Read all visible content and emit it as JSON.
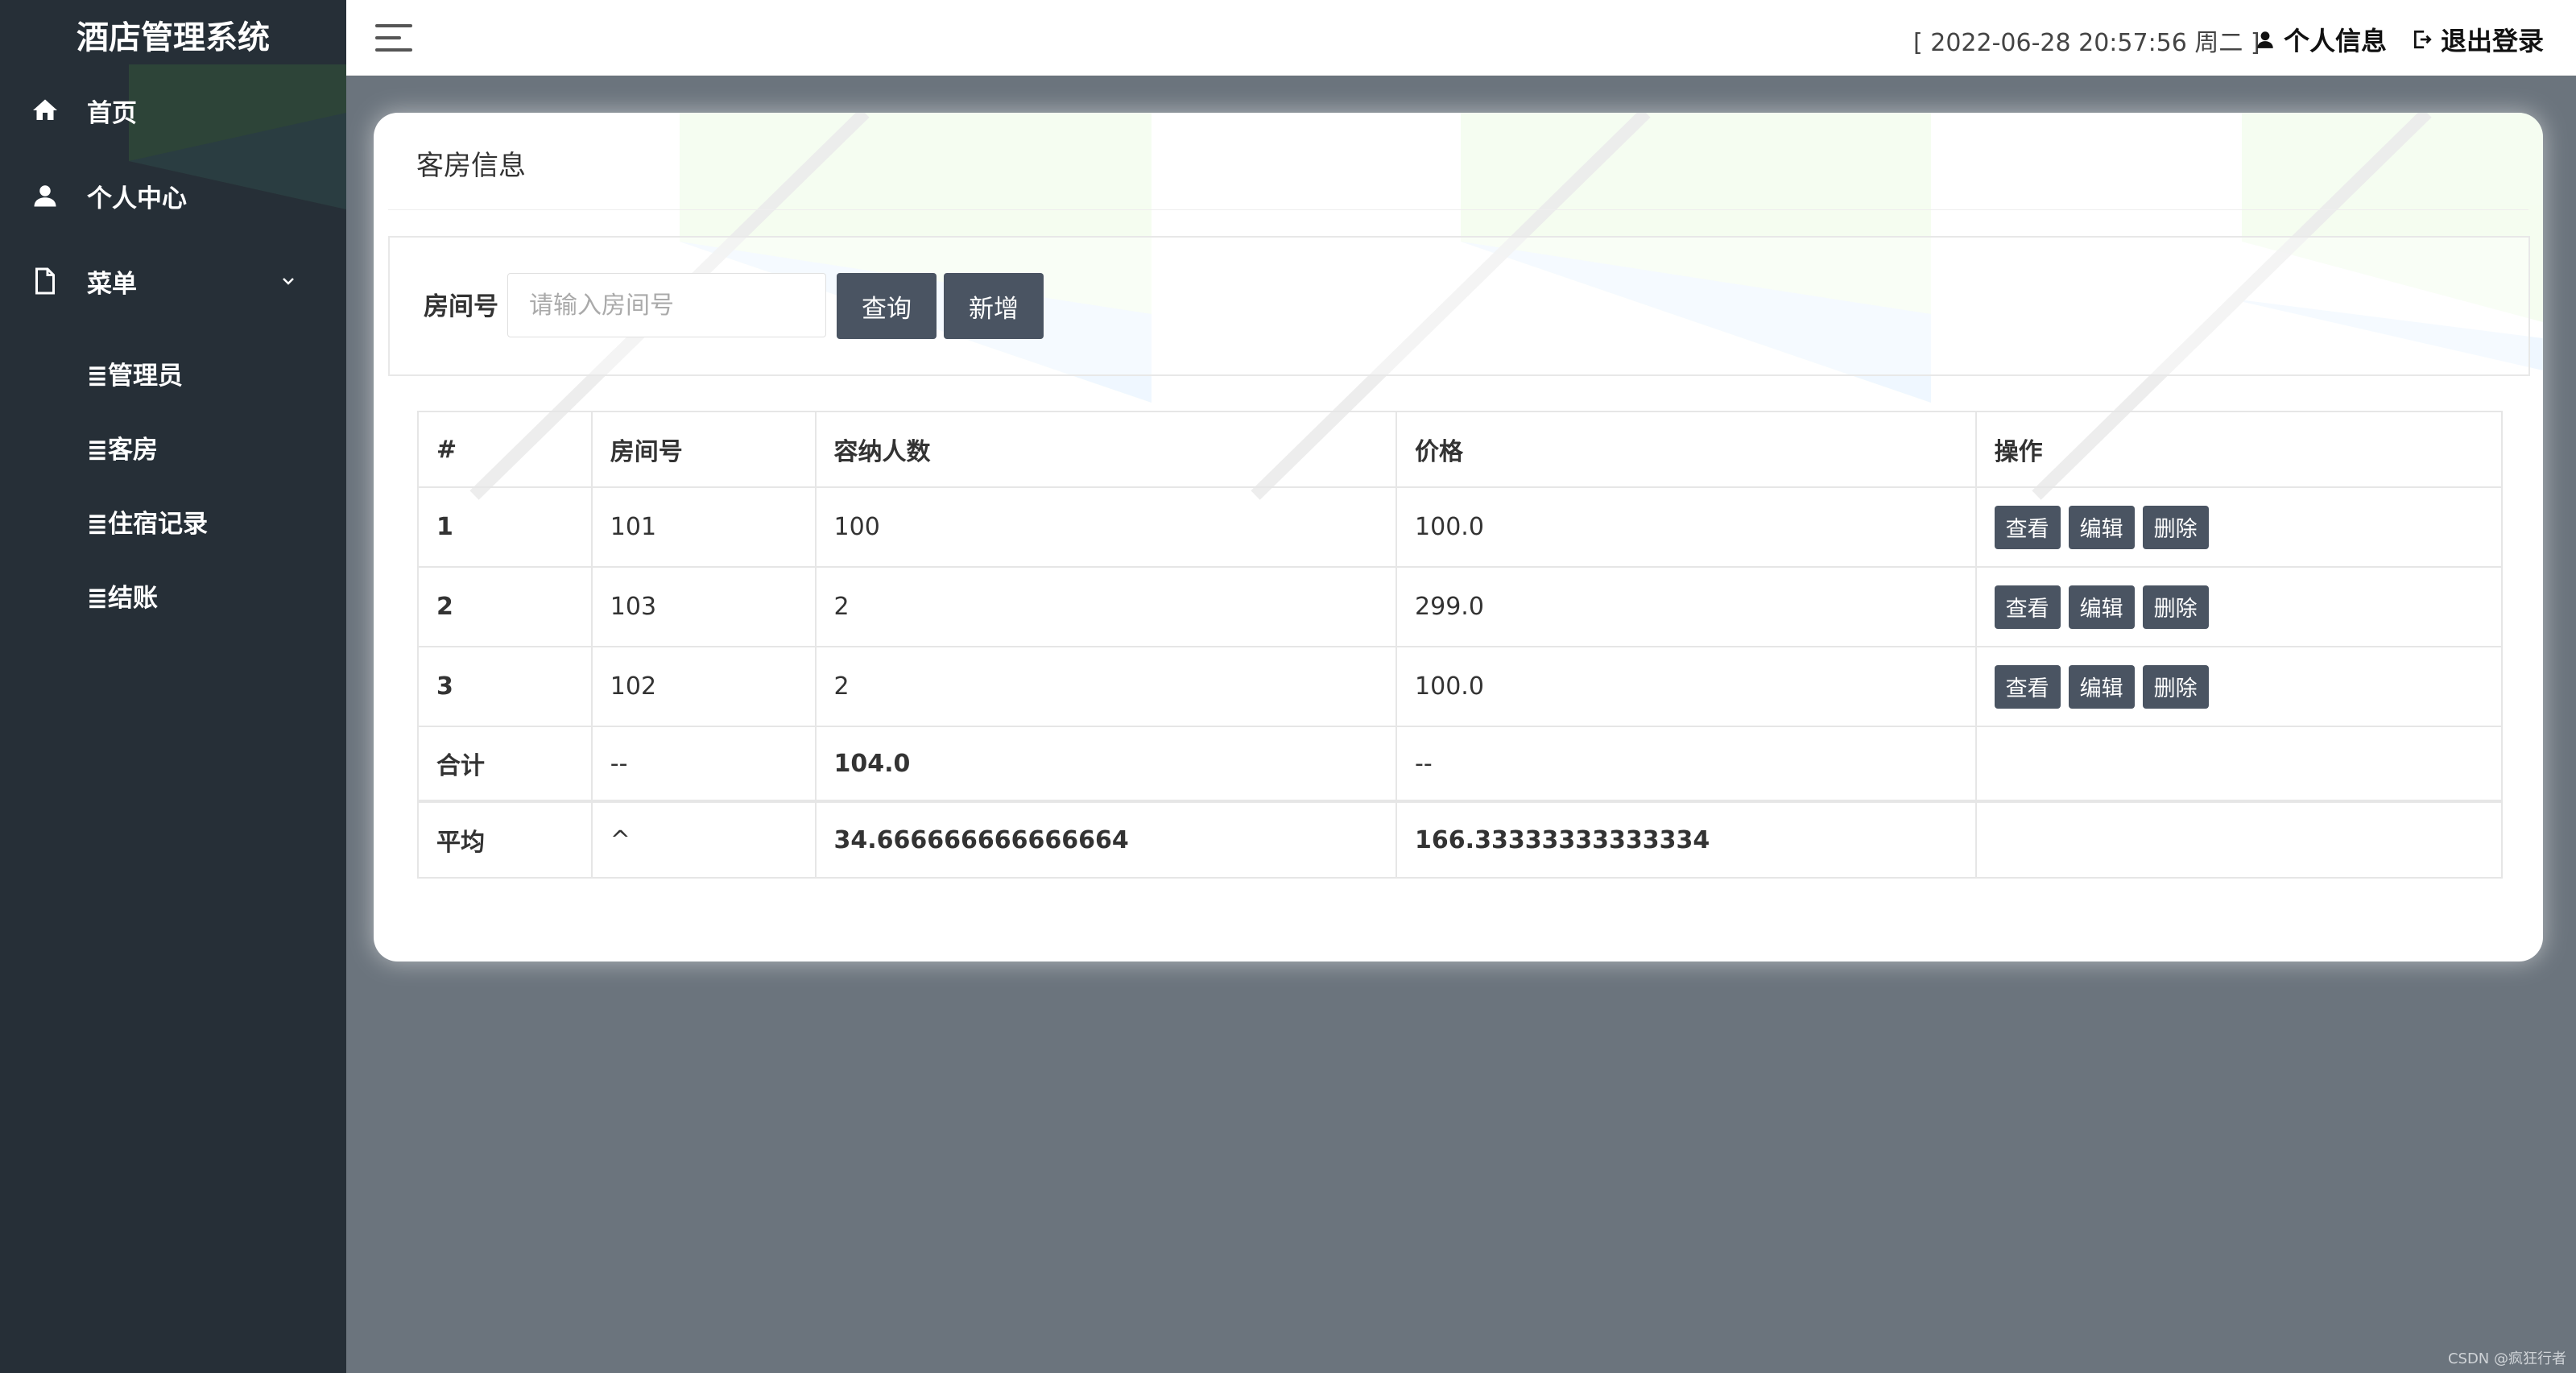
{
  "app": {
    "title": "酒店管理系统"
  },
  "sidebar": {
    "items": [
      {
        "label": "首页",
        "icon": "home-icon"
      },
      {
        "label": "个人中心",
        "icon": "user-icon"
      },
      {
        "label": "菜单",
        "icon": "document-icon"
      }
    ],
    "submenu": [
      {
        "label": "≣管理员"
      },
      {
        "label": "≣客房"
      },
      {
        "label": "≣住宿记录"
      },
      {
        "label": "≣结账"
      }
    ]
  },
  "header": {
    "datetime": "[ 2022-06-28 20:57:56 周二 ]",
    "profile_label": "个人信息",
    "logout_label": "退出登录"
  },
  "page": {
    "title": "客房信息"
  },
  "search": {
    "label": "房间号",
    "placeholder": "请输入房间号",
    "query_button": "查询",
    "add_button": "新增"
  },
  "table": {
    "headers": [
      "#",
      "房间号",
      "容纳人数",
      "价格",
      "操作"
    ],
    "rows": [
      {
        "index": "1",
        "room": "101",
        "capacity": "100",
        "price": "100.0"
      },
      {
        "index": "2",
        "room": "103",
        "capacity": "2",
        "price": "299.0"
      },
      {
        "index": "3",
        "room": "102",
        "capacity": "2",
        "price": "100.0"
      }
    ],
    "actions": {
      "view": "查看",
      "edit": "编辑",
      "delete": "删除"
    },
    "sum": {
      "label": "合计",
      "room": "--",
      "capacity": "104.0",
      "price": "--"
    },
    "avg": {
      "label": "平均",
      "room": "^",
      "capacity": "34.666666666666664",
      "price": "166.33333333333334"
    }
  },
  "footer": {
    "credit": "CSDN @疯狂行者"
  },
  "colors": {
    "sidebar": "#262f37",
    "background": "#6b747d",
    "button": "#4a5462"
  }
}
